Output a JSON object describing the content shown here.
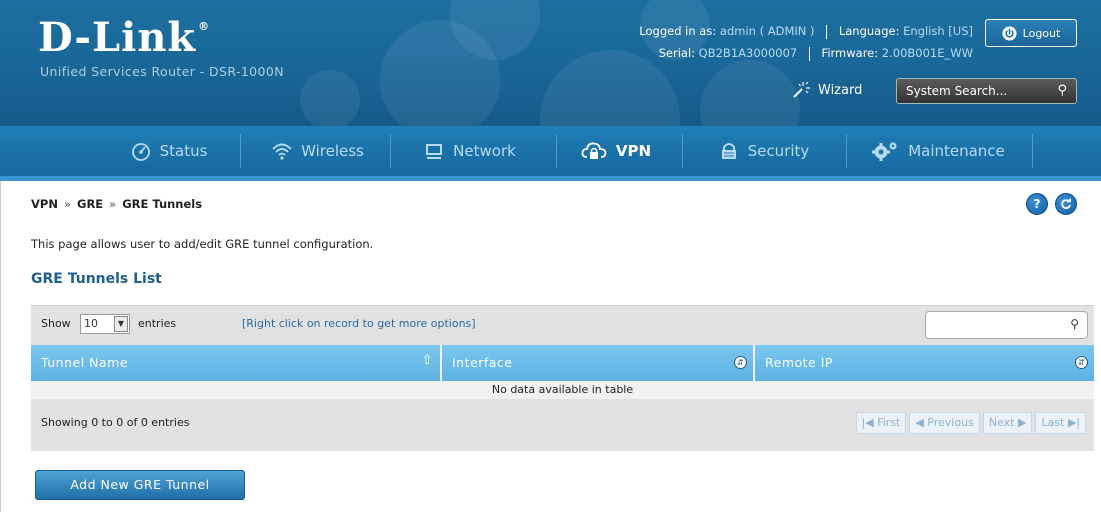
{
  "header": {
    "brand": "D-Link",
    "brand_mark": "®",
    "subtitle": "Unified Services Router - DSR-1000N",
    "logged_in_label": "Logged in as:",
    "logged_in_value": "admin ( ADMIN )",
    "language_label": "Language:",
    "language_value": "English [US]",
    "serial_label": "Serial:",
    "serial_value": "QB2B1A3000007",
    "firmware_label": "Firmware:",
    "firmware_value": "2.00B001E_WW",
    "logout_label": "Logout",
    "wizard_label": "Wizard",
    "search_placeholder": "System Search..."
  },
  "nav": {
    "items": [
      {
        "label": "Status",
        "icon": "dashboard-icon"
      },
      {
        "label": "Wireless",
        "icon": "wifi-icon"
      },
      {
        "label": "Network",
        "icon": "monitor-icon"
      },
      {
        "label": "VPN",
        "icon": "cloud-lock-icon",
        "active": true
      },
      {
        "label": "Security",
        "icon": "lock-icon"
      },
      {
        "label": "Maintenance",
        "icon": "gears-icon"
      }
    ]
  },
  "breadcrumb": {
    "items": [
      "VPN",
      "GRE",
      "GRE Tunnels"
    ],
    "separator": "»"
  },
  "page": {
    "description": "This page allows user to add/edit GRE tunnel configuration.",
    "list_title": "GRE Tunnels List"
  },
  "table": {
    "show_label": "Show",
    "entries_value": "10",
    "entries_label": "entries",
    "hint": "[Right click on record to get more options]",
    "columns": [
      "Tunnel Name",
      "Interface",
      "Remote IP"
    ],
    "empty_message": "No data available in table",
    "showing_text": "Showing 0 to 0 of 0 entries",
    "pager": {
      "first": "First",
      "previous": "Previous",
      "next": "Next",
      "last": "Last"
    }
  },
  "actions": {
    "add_label": "Add New GRE Tunnel"
  },
  "colors": {
    "header_blue": "#1a689a",
    "nav_blue": "#1a72a8",
    "table_header": "#6bbde9",
    "title_blue": "#1d5f8c"
  }
}
